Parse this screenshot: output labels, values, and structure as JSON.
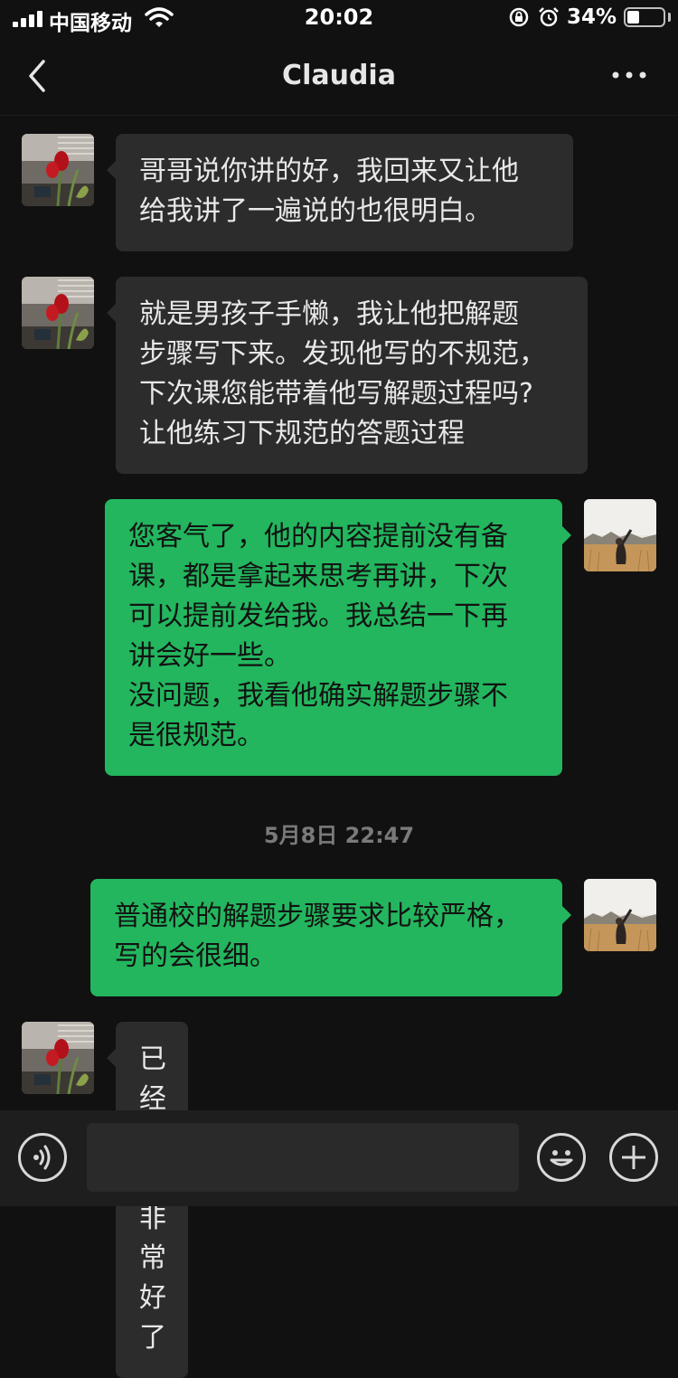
{
  "status_bar": {
    "carrier": "中国移动",
    "time": "20:02",
    "battery_percent": "34%",
    "battery_level": 0.34
  },
  "nav": {
    "title": "Claudia",
    "back_icon": "chevron-left-icon",
    "more_icon": "ellipsis-icon"
  },
  "messages": [
    {
      "side": "in",
      "text": "哥哥说你讲的好，我回来又让他\n给我讲了一遍说的也很明白。"
    },
    {
      "side": "in",
      "text": "就是男孩子手懒，我让他把解题\n步骤写下来。发现他写的不规范，\n下次课您能带着他写解题过程吗?\n让他练习下规范的答题过程"
    },
    {
      "side": "out",
      "text": "您客气了，他的内容提前没有备\n课，都是拿起来思考再讲，下次\n可以提前发给我。我总结一下再\n讲会好一些。\n没问题，我看他确实解题步骤不\n是很规范。"
    },
    {
      "side": "out",
      "text": "普通校的解题步骤要求比较严格，\n写的会很细。"
    },
    {
      "side": "in",
      "text": "已经讲的非常好了"
    }
  ],
  "timestamp": "5月8日 22:47",
  "input_bar": {
    "voice_icon": "voice-icon",
    "emoji_icon": "emoji-icon",
    "plus_icon": "plus-icon",
    "placeholder": ""
  },
  "colors": {
    "background": "#111111",
    "incoming_bubble": "#2c2c2c",
    "outgoing_bubble": "#23b65e"
  }
}
